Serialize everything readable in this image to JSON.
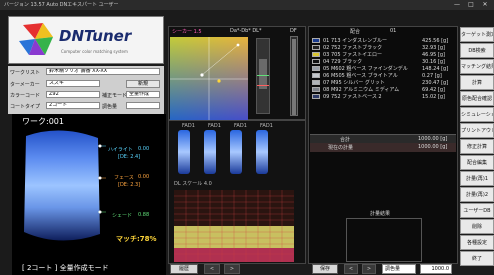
{
  "window": {
    "title": "バージョン 13.57   Auto DNエキスパート   ユーザー"
  },
  "logo": {
    "brand": "DNTuner",
    "tagline": "Computer color matching system"
  },
  "form": {
    "work_list_label": "ワークリスト",
    "work_list_value": "鈴木精ソリオ 壽番 XX-XX",
    "maker_label": "ターメーカー",
    "maker_value": "スズキ",
    "color_no_label": "カラーコード",
    "color_no_value": "Z92",
    "coat_label": "コートタイプ",
    "coat_value": "2コート",
    "new_btn": "新規",
    "adj_label": "補正モード",
    "adj_value": "全量作成",
    "paint_label": "調色量"
  },
  "work": {
    "title": "ワーク:001",
    "highlight_label": "ハイライト",
    "highlight_val": "0.00",
    "highlight_de": "[DE: 2.4]",
    "face_label": "フェース",
    "face_val": "0.00",
    "face_de": "[DE: 2.3]",
    "shade_label": "シェード",
    "shade_val": "0.88",
    "match_label": "マッチ:78%",
    "footer": "[ 2コート ]  全量作成モード"
  },
  "graph": {
    "title": "シーカー 1.5",
    "axis_label": "Da*-Db* DL*",
    "right_label": "DF"
  },
  "middle": {
    "samples": [
      "FAD1",
      "FAD1",
      "FAD1",
      "FAD1"
    ],
    "scale_label": "DL スケール 4.0",
    "prev_btn": "履歴",
    "nav_left": "<",
    "nav_right": ">"
  },
  "table": {
    "header_left": "",
    "header_title": "配合",
    "header_num": "01",
    "rows": [
      {
        "code": "01 713",
        "name": "インダスレンブルー",
        "val": "425.56 [g]",
        "color": "#1a3b8e"
      },
      {
        "code": "02 752",
        "name": "ファストブラック",
        "val": "32.93 [g]",
        "color": "#222222"
      },
      {
        "code": "03 705",
        "name": "ファストイエロー",
        "val": "46.95 [g]",
        "color": "#d8c431"
      },
      {
        "code": "04 729",
        "name": "ブラック",
        "val": "30.16 [g]",
        "color": "#111111"
      },
      {
        "code": "05 M602",
        "name": "粗ベース ファインダンデル",
        "val": "148.24 [g]",
        "color": "#9aa0a8"
      },
      {
        "code": "06 M505",
        "name": "粗ベース ブライトアル",
        "val": "0.27 [g]",
        "color": "#c4c8cc"
      },
      {
        "code": "07 M95",
        "name": "シルバー グリット",
        "val": "230.47 [g]",
        "color": "#b0b4b8"
      },
      {
        "code": "08 M92",
        "name": "アルミニウム ミディアム",
        "val": "69.42 [g]",
        "color": "#7c8088"
      },
      {
        "code": "09 752",
        "name": "ファストベース 2",
        "val": "15.02 [g]",
        "color": "#2e3b66"
      }
    ],
    "total_label": "合計",
    "total_val": "1000.00 [g]",
    "current_label": "現在の計量",
    "current_val": "1000.00 [g]",
    "result_title": "計量結果",
    "bottom_btn": "保存",
    "unit_label": "調色量",
    "amount": "1000.0"
  },
  "side": {
    "buttons": [
      "ターゲット測定",
      "DB検索",
      "マッチング結果",
      "計算",
      "原色配合確認",
      "シミュレーション",
      "プリントアウト",
      "修正計算",
      "配合編集",
      "計量(再)1",
      "計量(再)2",
      "ユーザーDB",
      "削除",
      "各種設定",
      "終了"
    ]
  }
}
